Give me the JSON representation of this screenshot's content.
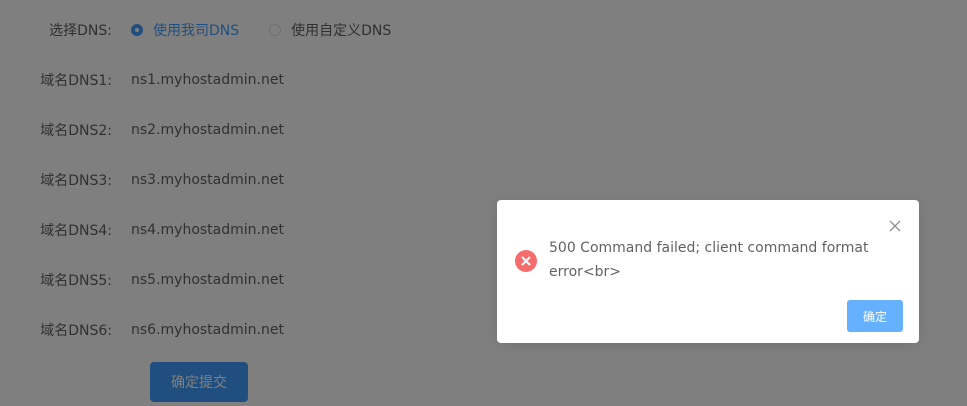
{
  "form": {
    "select_dns_label": "选择DNS:",
    "radio_options": [
      {
        "label": "使用我司DNS",
        "checked": true
      },
      {
        "label": "使用自定义DNS",
        "checked": false
      }
    ],
    "dns_rows": [
      {
        "label": "域名DNS1:",
        "value": "ns1.myhostadmin.net"
      },
      {
        "label": "域名DNS2:",
        "value": "ns2.myhostadmin.net"
      },
      {
        "label": "域名DNS3:",
        "value": "ns3.myhostadmin.net"
      },
      {
        "label": "域名DNS4:",
        "value": "ns4.myhostadmin.net"
      },
      {
        "label": "域名DNS5:",
        "value": "ns5.myhostadmin.net"
      },
      {
        "label": "域名DNS6:",
        "value": "ns6.myhostadmin.net"
      }
    ],
    "submit_label": "确定提交"
  },
  "dialog": {
    "message": "500 Command failed; client command format error<br>",
    "ok_label": "确定",
    "icon": "error-circle-icon",
    "close_icon": "close-icon"
  },
  "colors": {
    "accent": "#409eff",
    "error": "#f56c6c",
    "text": "#606266"
  }
}
